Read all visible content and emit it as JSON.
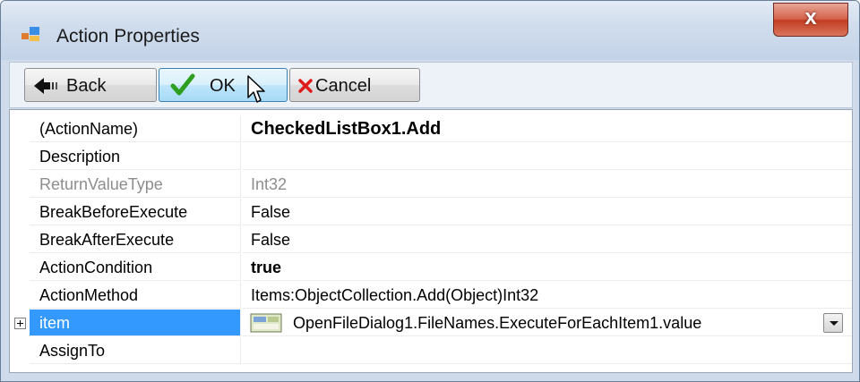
{
  "window": {
    "title": "Action Properties",
    "icon": "properties-icon",
    "close_label": "x"
  },
  "toolbar": {
    "back_label": "Back",
    "ok_label": "OK",
    "cancel_label": "Cancel"
  },
  "properties": [
    {
      "name": "(ActionName)",
      "value": "CheckedListBox1.Add"
    },
    {
      "name": "Description",
      "value": ""
    },
    {
      "name": "ReturnValueType",
      "value": "Int32"
    },
    {
      "name": "BreakBeforeExecute",
      "value": "False"
    },
    {
      "name": "BreakAfterExecute",
      "value": "False"
    },
    {
      "name": "ActionCondition",
      "value": "true"
    },
    {
      "name": "ActionMethod",
      "value": "Items:ObjectCollection.Add(Object)Int32"
    },
    {
      "name": "item",
      "value": "OpenFileDialog1.FileNames.ExecuteForEachItem1.value"
    },
    {
      "name": "AssignTo",
      "value": ""
    }
  ],
  "colors": {
    "selection": "#3399ff",
    "title_bar": "#cfdbea",
    "close_button": "#c94a30"
  }
}
